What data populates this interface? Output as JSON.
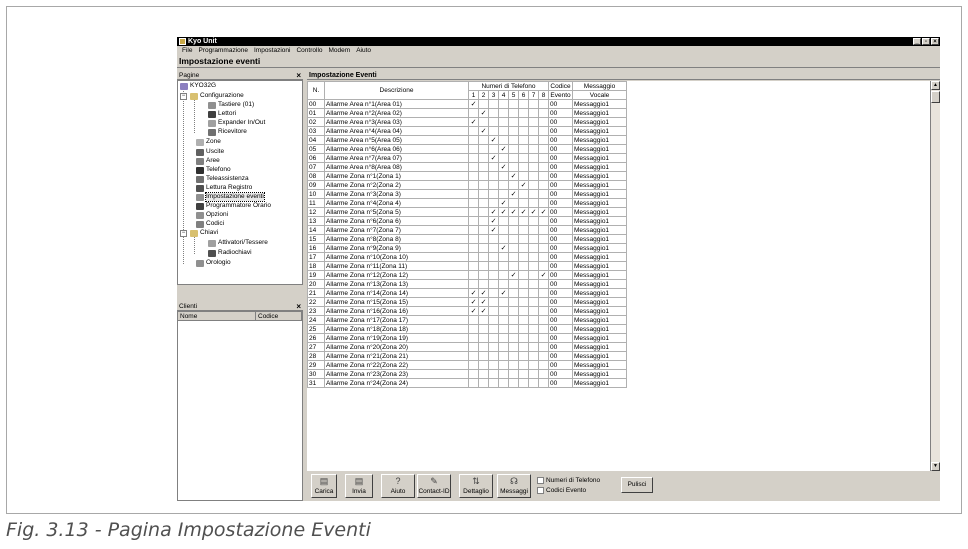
{
  "window": {
    "title": "Kyo Unit",
    "controls": [
      "_",
      "▫",
      "×"
    ]
  },
  "menu": [
    "File",
    "Programmazione",
    "Impostazioni",
    "Controllo",
    "Modem",
    "Aiuto"
  ],
  "page_title": "Impostazione eventi",
  "pagine": {
    "header": "Pagine",
    "close": "×",
    "tree": [
      {
        "label": "KYO32G"
      },
      {
        "label": "Configurazione"
      },
      {
        "label": "Tastiere (01)"
      },
      {
        "label": "Lettori"
      },
      {
        "label": "Expander In/Out"
      },
      {
        "label": "Ricevitore"
      },
      {
        "label": "Zone"
      },
      {
        "label": "Uscite"
      },
      {
        "label": "Aree"
      },
      {
        "label": "Telefono"
      },
      {
        "label": "Teleassistenza"
      },
      {
        "label": "Lettura Registro"
      },
      {
        "label": "Impostazione eventi"
      },
      {
        "label": "Programmatore Orario"
      },
      {
        "label": "Opzioni"
      },
      {
        "label": "Codici"
      },
      {
        "label": "Chiavi"
      },
      {
        "label": "Attivatori/Tessere"
      },
      {
        "label": "Radiochiavi"
      },
      {
        "label": "Orologio"
      }
    ]
  },
  "clienti": {
    "header": "Clienti",
    "close": "×",
    "col_nome": "Nome",
    "col_codice": "Codice"
  },
  "main": {
    "header": "Impostazione Eventi",
    "col_n": "N.",
    "col_desc": "Descrizione",
    "col_phones": "Numeri di Telefono",
    "phone_nums": [
      "1",
      "2",
      "3",
      "4",
      "5",
      "6",
      "7",
      "8"
    ],
    "col_codice_1": "Codice",
    "col_codice_2": "Evento",
    "col_msg_1": "Messaggio",
    "col_msg_2": "Vocale",
    "check_glyph": "✓",
    "rows": [
      {
        "n": "00",
        "desc": "Allarme Area n°1(Area 01)",
        "checks": [
          1
        ],
        "code": "00",
        "msg": "Messaggio1"
      },
      {
        "n": "01",
        "desc": "Allarme Area n°2(Area 02)",
        "checks": [
          2
        ],
        "code": "00",
        "msg": "Messaggio1"
      },
      {
        "n": "02",
        "desc": "Allarme Area n°3(Area 03)",
        "checks": [
          1
        ],
        "code": "00",
        "msg": "Messaggio1"
      },
      {
        "n": "03",
        "desc": "Allarme Area n°4(Area 04)",
        "checks": [
          2
        ],
        "code": "00",
        "msg": "Messaggio1"
      },
      {
        "n": "04",
        "desc": "Allarme Area n°5(Area 05)",
        "checks": [
          3
        ],
        "code": "00",
        "msg": "Messaggio1"
      },
      {
        "n": "05",
        "desc": "Allarme Area n°6(Area 06)",
        "checks": [
          4
        ],
        "code": "00",
        "msg": "Messaggio1"
      },
      {
        "n": "06",
        "desc": "Allarme Area n°7(Area 07)",
        "checks": [
          3
        ],
        "code": "00",
        "msg": "Messaggio1"
      },
      {
        "n": "07",
        "desc": "Allarme Area n°8(Area 08)",
        "checks": [
          4
        ],
        "code": "00",
        "msg": "Messaggio1"
      },
      {
        "n": "08",
        "desc": "Allarme Zona n°1(Zona 1)",
        "checks": [
          5
        ],
        "code": "00",
        "msg": "Messaggio1"
      },
      {
        "n": "09",
        "desc": "Allarme Zona n°2(Zona 2)",
        "checks": [
          6
        ],
        "code": "00",
        "msg": "Messaggio1"
      },
      {
        "n": "10",
        "desc": "Allarme Zona n°3(Zona 3)",
        "checks": [
          5
        ],
        "code": "00",
        "msg": "Messaggio1"
      },
      {
        "n": "11",
        "desc": "Allarme Zona n°4(Zona 4)",
        "checks": [
          4
        ],
        "code": "00",
        "msg": "Messaggio1"
      },
      {
        "n": "12",
        "desc": "Allarme Zona n°5(Zona 5)",
        "checks": [
          3,
          4,
          5,
          6,
          7,
          8
        ],
        "code": "00",
        "msg": "Messaggio1"
      },
      {
        "n": "13",
        "desc": "Allarme Zona n°6(Zona 6)",
        "checks": [
          3
        ],
        "code": "00",
        "msg": "Messaggio1"
      },
      {
        "n": "14",
        "desc": "Allarme Zona n°7(Zona 7)",
        "checks": [
          3
        ],
        "code": "00",
        "msg": "Messaggio1"
      },
      {
        "n": "15",
        "desc": "Allarme Zona n°8(Zona 8)",
        "checks": [],
        "code": "00",
        "msg": "Messaggio1"
      },
      {
        "n": "16",
        "desc": "Allarme Zona n°9(Zona 9)",
        "checks": [
          4
        ],
        "code": "00",
        "msg": "Messaggio1"
      },
      {
        "n": "17",
        "desc": "Allarme Zona n°10(Zona 10)",
        "checks": [],
        "code": "00",
        "msg": "Messaggio1"
      },
      {
        "n": "18",
        "desc": "Allarme Zona n°11(Zona 11)",
        "checks": [],
        "code": "00",
        "msg": "Messaggio1"
      },
      {
        "n": "19",
        "desc": "Allarme Zona n°12(Zona 12)",
        "checks": [
          5,
          8
        ],
        "code": "00",
        "msg": "Messaggio1"
      },
      {
        "n": "20",
        "desc": "Allarme Zona n°13(Zona 13)",
        "checks": [],
        "code": "00",
        "msg": "Messaggio1"
      },
      {
        "n": "21",
        "desc": "Allarme Zona n°14(Zona 14)",
        "checks": [
          1,
          2,
          4
        ],
        "code": "00",
        "msg": "Messaggio1"
      },
      {
        "n": "22",
        "desc": "Allarme Zona n°15(Zona 15)",
        "checks": [
          1,
          2
        ],
        "code": "00",
        "msg": "Messaggio1"
      },
      {
        "n": "23",
        "desc": "Allarme Zona n°16(Zona 16)",
        "checks": [
          1,
          2
        ],
        "code": "00",
        "msg": "Messaggio1"
      },
      {
        "n": "24",
        "desc": "Allarme Zona n°17(Zona 17)",
        "checks": [],
        "code": "00",
        "msg": "Messaggio1"
      },
      {
        "n": "25",
        "desc": "Allarme Zona n°18(Zona 18)",
        "checks": [],
        "code": "00",
        "msg": "Messaggio1"
      },
      {
        "n": "26",
        "desc": "Allarme Zona n°19(Zona 19)",
        "checks": [],
        "code": "00",
        "msg": "Messaggio1"
      },
      {
        "n": "27",
        "desc": "Allarme Zona n°20(Zona 20)",
        "checks": [],
        "code": "00",
        "msg": "Messaggio1"
      },
      {
        "n": "28",
        "desc": "Allarme Zona n°21(Zona 21)",
        "checks": [],
        "code": "00",
        "msg": "Messaggio1"
      },
      {
        "n": "29",
        "desc": "Allarme Zona n°22(Zona 22)",
        "checks": [],
        "code": "00",
        "msg": "Messaggio1"
      },
      {
        "n": "30",
        "desc": "Allarme Zona n°23(Zona 23)",
        "checks": [],
        "code": "00",
        "msg": "Messaggio1"
      },
      {
        "n": "31",
        "desc": "Allarme Zona n°24(Zona 24)",
        "checks": [],
        "code": "00",
        "msg": "Messaggio1"
      }
    ]
  },
  "toolbar": {
    "buttons": [
      {
        "label": "Carica",
        "icon": "load-icon"
      },
      {
        "label": "Invia",
        "icon": "send-icon"
      },
      {
        "label": "Aiuto",
        "icon": "help-icon"
      },
      {
        "label": "Contact-ID",
        "icon": "contact-id-icon"
      },
      {
        "label": "Dettaglio",
        "icon": "detail-icon"
      },
      {
        "label": "Messaggi",
        "icon": "messages-icon"
      }
    ],
    "checks": [
      "Numeri di Telefono",
      "Codici Evento"
    ],
    "pulisci": "Pulisci"
  },
  "caption": "Fig. 3.13 - Pagina Impostazione Eventi"
}
